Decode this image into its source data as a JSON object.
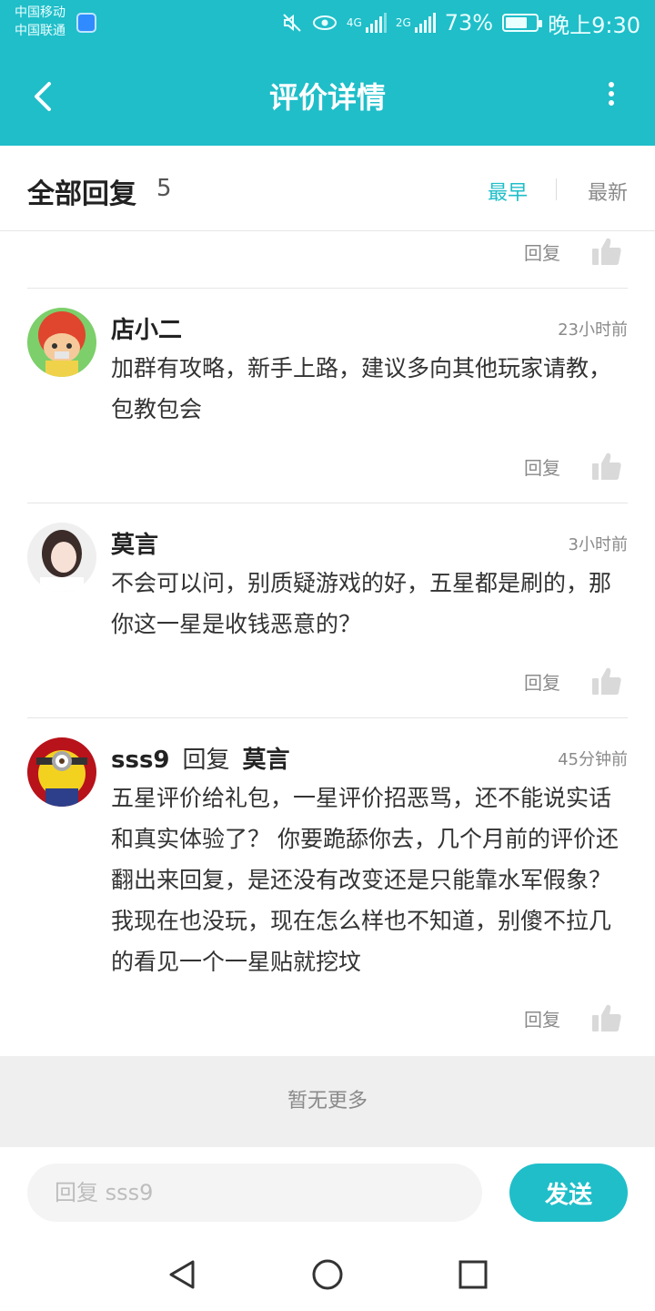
{
  "status_bar": {
    "carrier1": "中国移动",
    "carrier2": "中国联通",
    "net1": "4G",
    "net2": "2G",
    "battery_text": "73%",
    "battery_level": 0.73,
    "time": "晚上9:30",
    "icons": [
      "mute-icon",
      "eye-icon",
      "signal-icon",
      "battery-icon"
    ]
  },
  "topbar": {
    "title": "评价详情"
  },
  "header": {
    "all_label": "全部回复",
    "count": "5",
    "sort_earliest": "最早",
    "sort_latest": "最新"
  },
  "reply_label": "回复",
  "comments": [
    {
      "author": "店小二",
      "time": "23小时前",
      "text": "加群有攻略，新手上路，建议多向其他玩家请教，包教包会"
    },
    {
      "author": "莫言",
      "time": "3小时前",
      "text": "不会可以问，别质疑游戏的好，五星都是刷的，那你这一星是收钱恶意的？"
    },
    {
      "author": "sss9",
      "reply_word": "回复",
      "reply_to": "莫言",
      "time": "45分钟前",
      "text": "五星评价给礼包，一星评价招恶骂，还不能说实话和真实体验了？ 你要跪舔你去，几个月前的评价还翻出来回复，是还没有改变还是只能靠水军假象？ 我现在也没玩，现在怎么样也不知道，别傻不拉几的看见一个一星贴就挖坟"
    }
  ],
  "footer": {
    "no_more": "暂无更多"
  },
  "input": {
    "placeholder": "回复 sss9",
    "send_label": "发送"
  },
  "colors": {
    "accent": "#1fbec9",
    "text_dark": "#222222",
    "text_muted": "#8a8a8a"
  }
}
